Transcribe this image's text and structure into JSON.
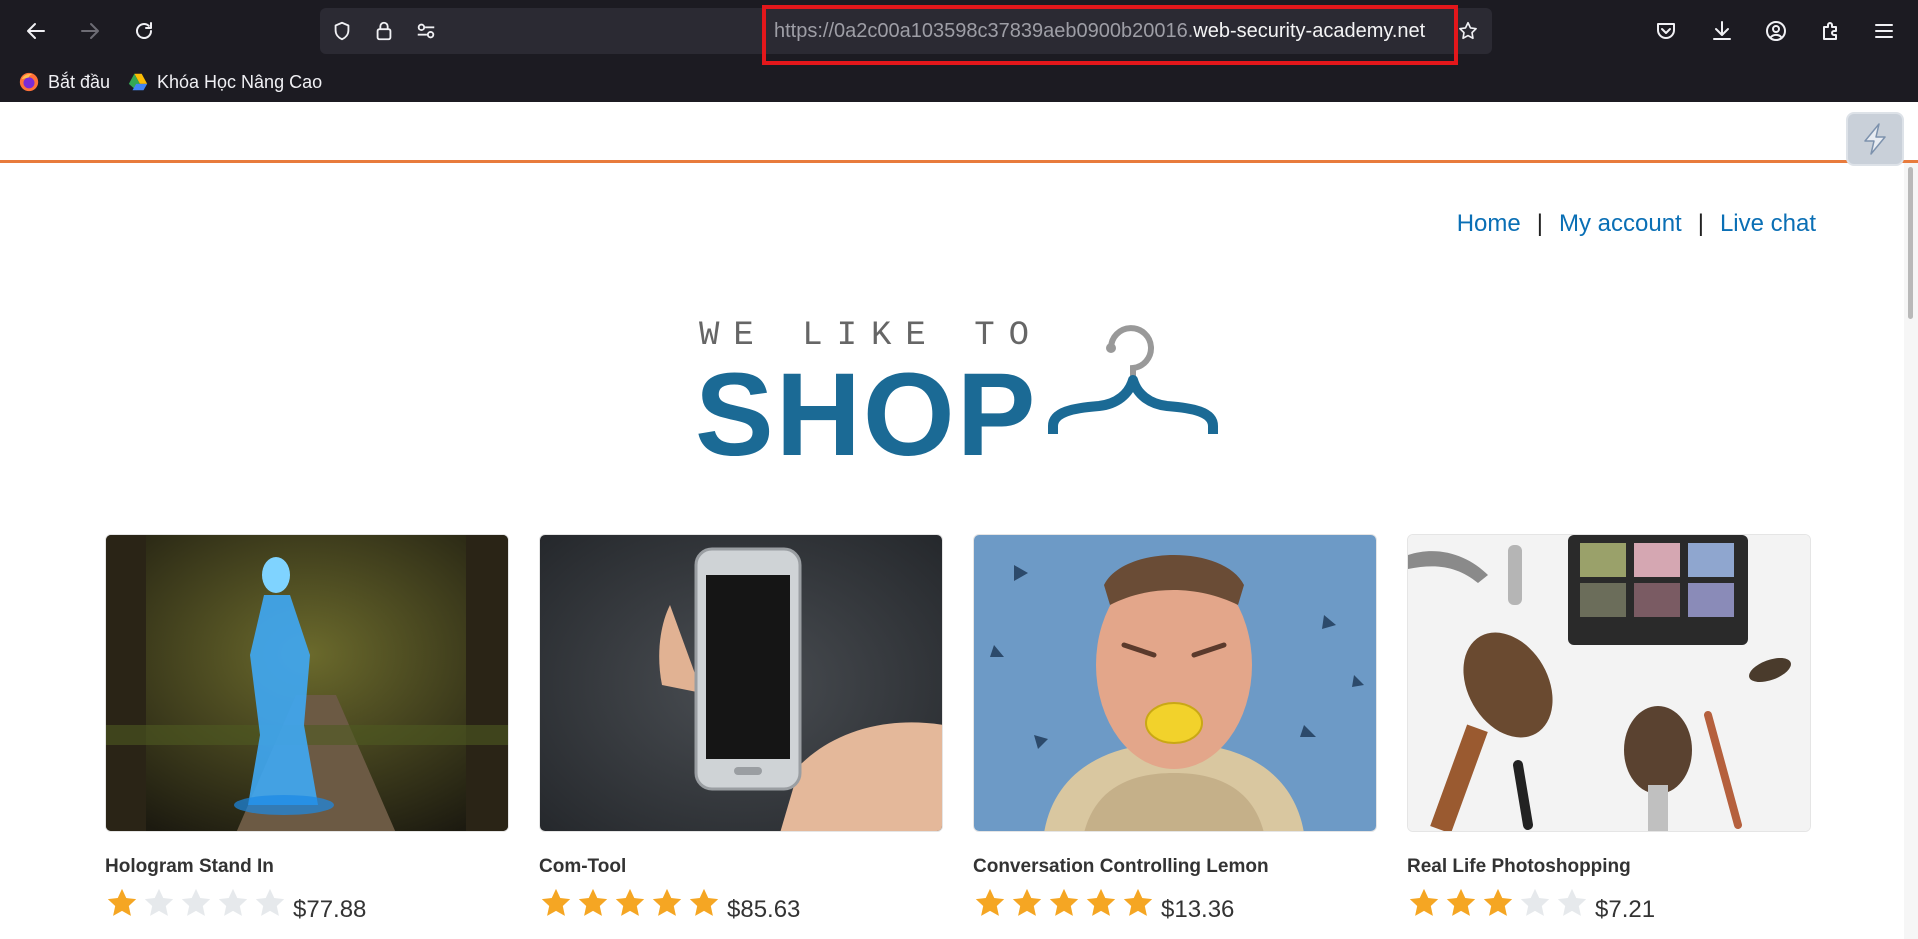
{
  "browser": {
    "url_dim": "https://0a2c00a103598c37839aeb0900b20016.",
    "url_bright": "web-security-academy.net",
    "bookmarks": [
      {
        "label": "Bắt đầu",
        "icon": "firefox-icon"
      },
      {
        "label": "Khóa Học Nâng Cao",
        "icon": "google-drive-icon"
      }
    ]
  },
  "nav": {
    "home": "Home",
    "separator": "|",
    "my_account": "My account",
    "live_chat": "Live chat"
  },
  "hero": {
    "tagline": "WE LIKE TO",
    "shop": "SHOP"
  },
  "products": [
    {
      "title": "Hologram Stand In",
      "rating": 1,
      "price": "$77.88"
    },
    {
      "title": "Com-Tool",
      "rating": 5,
      "price": "$85.63"
    },
    {
      "title": "Conversation Controlling Lemon",
      "rating": 5,
      "price": "$13.36"
    },
    {
      "title": "Real Life Photoshopping",
      "rating": 3,
      "price": "$7.21"
    }
  ],
  "colors": {
    "accent_orange": "#e87b3c",
    "link_blue": "#0a6fb5",
    "shop_blue": "#1b6a95",
    "star_gold": "#f5a623",
    "star_empty": "#e6e9ec"
  }
}
